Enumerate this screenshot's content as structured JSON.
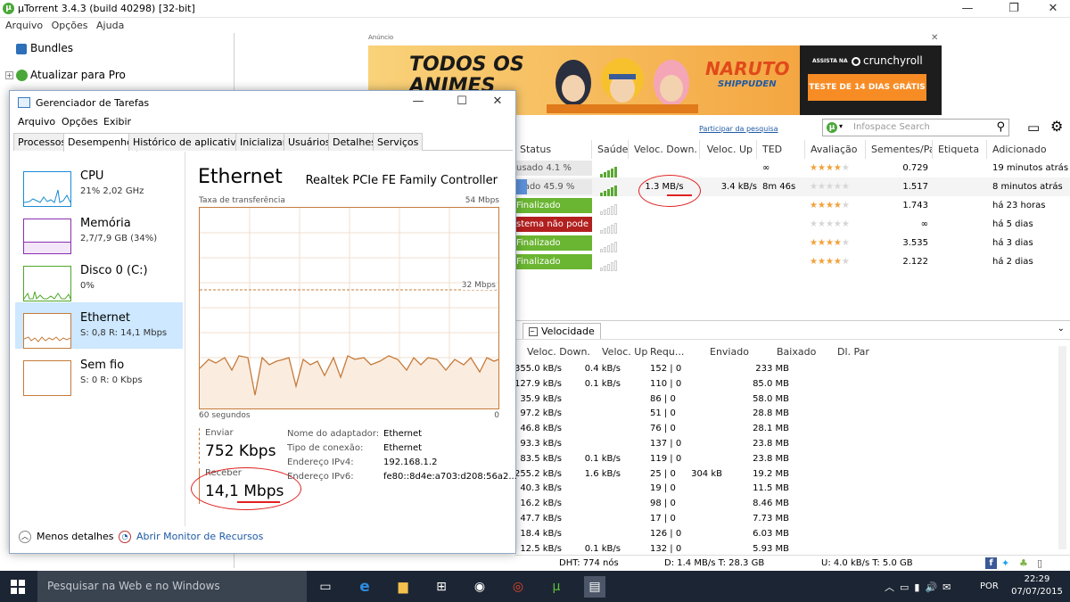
{
  "utorrent": {
    "title": "µTorrent 3.4.3  (build 40298) [32-bit]",
    "menu": [
      "Arquivo",
      "Opções",
      "Ajuda"
    ],
    "sidebar": {
      "items": [
        {
          "label": "Bundles"
        },
        {
          "label": "Atualizar para Pro"
        }
      ]
    },
    "ad": {
      "label": "Anúncio",
      "headline_line1": "TODOS OS",
      "headline_line2": "ANIMES",
      "series_logo": "NARUTO",
      "series_sub": "SHIPPUDEN",
      "sponsor_small": "ASSISTA NA",
      "sponsor": "crunchyroll",
      "cta": "TESTE DE 14 DIAS GRÁTIS",
      "search_link": "Participar da pesquisa"
    },
    "search": {
      "placeholder": "Infospace Search"
    },
    "columns": [
      "Status",
      "Saúde",
      "Veloc. Down.",
      "Veloc. Up",
      "TED",
      "Avaliação",
      "Sementes/Pa...",
      "Etiqueta",
      "Adicionado"
    ],
    "torrents": [
      {
        "status": "usado 4.1 %",
        "status_color": "#e8e8e8",
        "status_text_color": "#555",
        "health": 5,
        "down": "",
        "up": "",
        "ted": "∞",
        "rating": 4,
        "seeds": "0.729",
        "label": "",
        "added": "19 minutos atrás"
      },
      {
        "status": "ixado 45.9 %",
        "status_color": "#e8e8e8",
        "status_text_color": "#555",
        "health": 5,
        "down": "1.3 MB/s",
        "up": "3.4 kB/s",
        "ted": "8m 46s",
        "rating": 0,
        "seeds": "1.517",
        "label": "",
        "added": "8 minutos atrás"
      },
      {
        "status": "Finalizado",
        "status_color": "#6ab531",
        "status_text_color": "#fff",
        "health": 0,
        "down": "",
        "up": "",
        "ted": "",
        "rating": 4,
        "seeds": "1.743",
        "label": "",
        "added": "há 23 horas"
      },
      {
        "status": "stema não pode en",
        "status_color": "#b21f1f",
        "status_text_color": "#fff",
        "health": 0,
        "down": "",
        "up": "",
        "ted": "",
        "rating": 0,
        "seeds": "∞",
        "label": "",
        "added": "há 5 dias"
      },
      {
        "status": "Finalizado",
        "status_color": "#6ab531",
        "status_text_color": "#fff",
        "health": 0,
        "down": "",
        "up": "",
        "ted": "",
        "rating": 4,
        "seeds": "3.535",
        "label": "",
        "added": "há 3 dias"
      },
      {
        "status": "Finalizado",
        "status_color": "#6ab531",
        "status_text_color": "#fff",
        "health": 0,
        "down": "",
        "up": "",
        "ted": "",
        "rating": 4,
        "seeds": "2.122",
        "label": "",
        "added": "há 2 dias"
      }
    ],
    "speed_tab": "Velocidade",
    "peer_columns": [
      "Veloc. Down.",
      "Veloc. Up",
      "Requ...",
      "Enviado",
      "Baixado",
      "Dl. Par"
    ],
    "peers": [
      {
        "down": "355.0 kB/s",
        "up": "0.4 kB/s",
        "req": "152 | 0",
        "sent": "",
        "got": "233 MB"
      },
      {
        "down": "127.9 kB/s",
        "up": "0.1 kB/s",
        "req": "110 | 0",
        "sent": "",
        "got": "85.0 MB"
      },
      {
        "down": "35.9 kB/s",
        "up": "",
        "req": "86 | 0",
        "sent": "",
        "got": "58.0 MB"
      },
      {
        "down": "97.2 kB/s",
        "up": "",
        "req": "51 | 0",
        "sent": "",
        "got": "28.8 MB"
      },
      {
        "down": "46.8 kB/s",
        "up": "",
        "req": "76 | 0",
        "sent": "",
        "got": "28.1 MB"
      },
      {
        "down": "93.3 kB/s",
        "up": "",
        "req": "137 | 0",
        "sent": "",
        "got": "23.8 MB"
      },
      {
        "down": "83.5 kB/s",
        "up": "0.1 kB/s",
        "req": "119 | 0",
        "sent": "",
        "got": "23.8 MB"
      },
      {
        "down": "255.2 kB/s",
        "up": "1.6 kB/s",
        "req": "25 | 0",
        "sent": "304 kB",
        "got": "19.2 MB"
      },
      {
        "down": "40.3 kB/s",
        "up": "",
        "req": "19 | 0",
        "sent": "",
        "got": "11.5 MB"
      },
      {
        "down": "16.2 kB/s",
        "up": "",
        "req": "98 | 0",
        "sent": "",
        "got": "8.46 MB"
      },
      {
        "down": "47.7 kB/s",
        "up": "",
        "req": "17 | 0",
        "sent": "",
        "got": "7.73 MB"
      },
      {
        "down": "18.4 kB/s",
        "up": "",
        "req": "126 | 0",
        "sent": "",
        "got": "6.03 MB"
      },
      {
        "down": "12.5 kB/s",
        "up": "0.1 kB/s",
        "req": "132 | 0",
        "sent": "",
        "got": "5.93 MB"
      }
    ],
    "status_bar": {
      "dht": "DHT: 774 nós",
      "down": "D: 1.4 MB/s T: 28.3 GB",
      "up": "U: 4.0 kB/s T: 5.0 GB"
    }
  },
  "taskmgr": {
    "title": "Gerenciador de Tarefas",
    "menu": [
      "Arquivo",
      "Opções",
      "Exibir"
    ],
    "tabs": [
      "Processos",
      "Desempenho",
      "Histórico de aplicativos",
      "Inicializar",
      "Usuários",
      "Detalhes",
      "Serviços"
    ],
    "active_tab": "Desempenho",
    "perf_items": [
      {
        "name": "CPU",
        "sub": "21% 2,02 GHz",
        "color": "#1a8bd6"
      },
      {
        "name": "Memória",
        "sub": "2,7/7,9 GB (34%)",
        "color": "#8b2fb0"
      },
      {
        "name": "Disco 0 (C:)",
        "sub": "0%",
        "color": "#4ea72a"
      },
      {
        "name": "Ethernet",
        "sub": "S: 0,8 R: 14,1 Mbps",
        "color": "#c57b3a"
      },
      {
        "name": "Sem fio",
        "sub": "S: 0 R: 0 Kbps",
        "color": "#c57b3a"
      }
    ],
    "ethernet": {
      "title": "Ethernet",
      "adapter": "Realtek PCIe FE Family Controller",
      "graph_label": "Taxa de transferência",
      "max_label": "54 Mbps",
      "mid_label": "32 Mbps",
      "time_label": "60 segundos",
      "zero_label": "0",
      "send_label": "Enviar",
      "send_value": "752 Kbps",
      "recv_label": "Receber",
      "recv_value": "14,1 Mbps",
      "details": [
        {
          "k": "Nome do adaptador:",
          "v": "Ethernet"
        },
        {
          "k": "Tipo de conexão:",
          "v": "Ethernet"
        },
        {
          "k": "Endereço IPv4:",
          "v": "192.168.1.2"
        },
        {
          "k": "Endereço IPv6:",
          "v": "fe80::8d4e:a703:d208:56a2..."
        }
      ]
    },
    "footer": {
      "less": "Menos detalhes",
      "open": "Abrir Monitor de Recursos"
    }
  },
  "taskbar": {
    "search_placeholder": "Pesquisar na Web e no Windows",
    "lang": "POR",
    "time": "22:29",
    "date": "07/07/2015"
  }
}
